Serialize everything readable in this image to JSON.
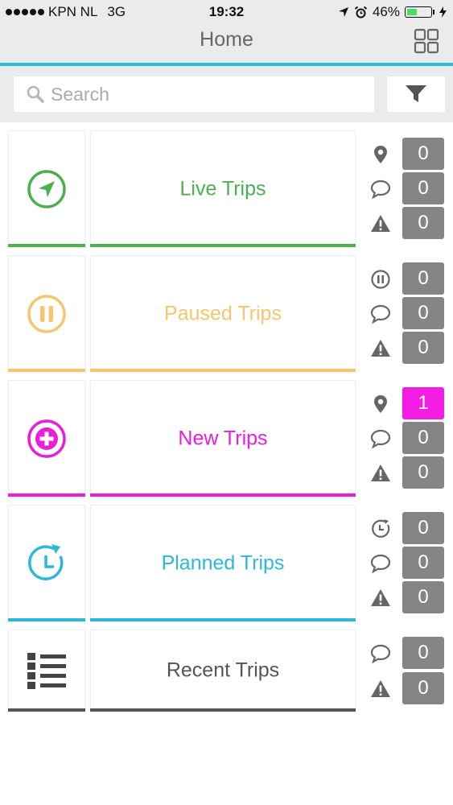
{
  "status_bar": {
    "carrier": "KPN NL",
    "network": "3G",
    "time": "19:32",
    "battery": "46%",
    "battery_level": 0.46
  },
  "header": {
    "title": "Home",
    "menu_icon": "grid-icon"
  },
  "search": {
    "placeholder": "Search",
    "value": "",
    "filter_icon": "filter-icon"
  },
  "colors": {
    "accent": "#2bb8d9",
    "live": "#4caf50",
    "paused": "#f5c66e",
    "new": "#e91ed8",
    "planned": "#2bb8d9",
    "recent": "#555555",
    "badge": "#858585",
    "badge_highlight": "#f31ce3"
  },
  "trips": [
    {
      "label": "Live Trips",
      "icon": "navigation-icon",
      "color": "#4caf50",
      "counters": [
        {
          "icon": "location-pin-icon",
          "value": "0"
        },
        {
          "icon": "comment-icon",
          "value": "0"
        },
        {
          "icon": "warning-icon",
          "value": "0"
        }
      ]
    },
    {
      "label": "Paused Trips",
      "icon": "pause-icon",
      "color": "#f5c66e",
      "counters": [
        {
          "icon": "pause-icon",
          "value": "0"
        },
        {
          "icon": "comment-icon",
          "value": "0"
        },
        {
          "icon": "warning-icon",
          "value": "0"
        }
      ]
    },
    {
      "label": "New Trips",
      "icon": "add-icon",
      "color": "#e91ed8",
      "counters": [
        {
          "icon": "location-pin-icon",
          "value": "1",
          "highlight": true
        },
        {
          "icon": "comment-icon",
          "value": "0"
        },
        {
          "icon": "warning-icon",
          "value": "0"
        }
      ]
    },
    {
      "label": "Planned Trips",
      "icon": "schedule-icon",
      "color": "#2bb8d9",
      "counters": [
        {
          "icon": "clock-icon",
          "value": "0"
        },
        {
          "icon": "comment-icon",
          "value": "0"
        },
        {
          "icon": "warning-icon",
          "value": "0"
        }
      ]
    },
    {
      "label": "Recent Trips",
      "icon": "list-icon",
      "color": "#555555",
      "counters": [
        {
          "icon": "comment-icon",
          "value": "0"
        },
        {
          "icon": "warning-icon",
          "value": "0"
        }
      ]
    }
  ]
}
